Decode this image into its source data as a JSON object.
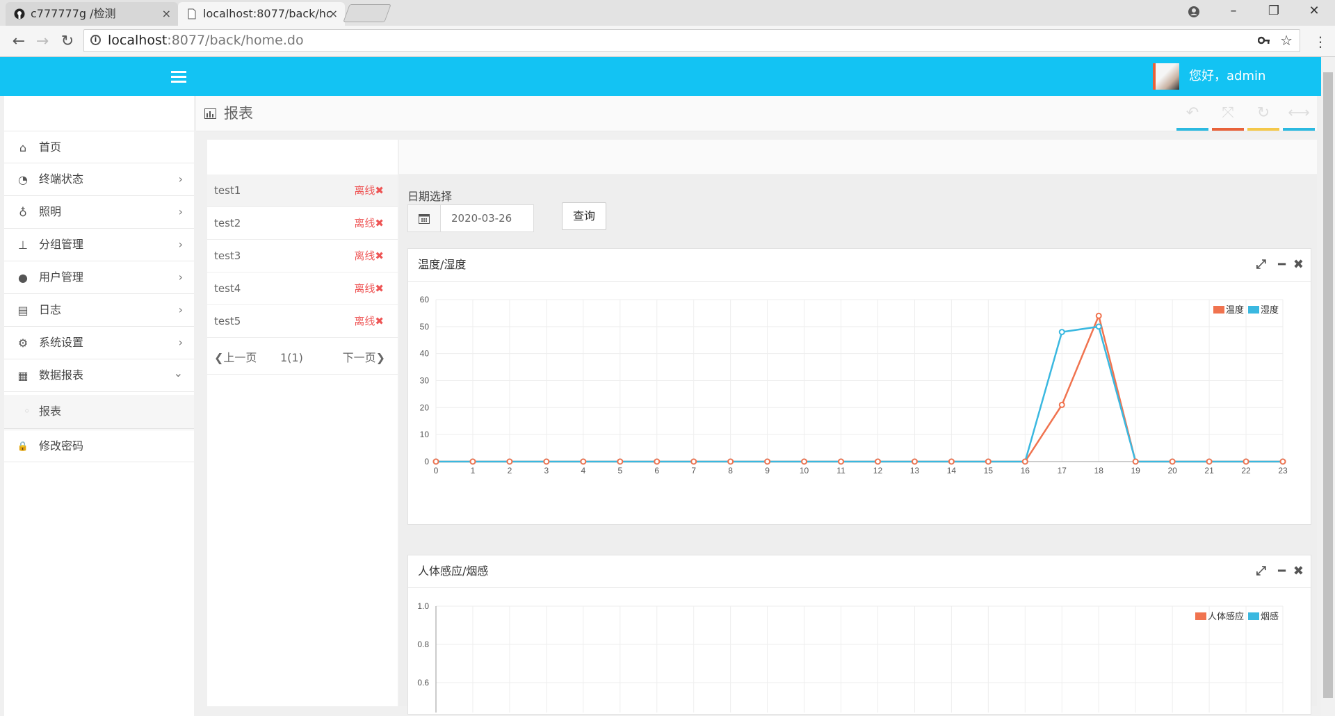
{
  "browser": {
    "tabs": [
      {
        "title": "c777777g /检测",
        "close": "×"
      },
      {
        "title": "localhost:8077/back/hc",
        "close": "×"
      }
    ],
    "url_host": "localhost",
    "url_rest": ":8077/back/home.do",
    "window_controls": {
      "minimize": "–",
      "maximize": "❐",
      "close": "✕"
    }
  },
  "header": {
    "greeting": "您好，admin"
  },
  "sidebar": {
    "items": [
      {
        "label": "首页",
        "icon": "home-icon",
        "glyph": "⌂"
      },
      {
        "label": "终端状态",
        "icon": "dashboard-icon",
        "glyph": "◔",
        "chevron": "›"
      },
      {
        "label": "照明",
        "icon": "lightbulb-icon",
        "glyph": "♁",
        "chevron": "›"
      },
      {
        "label": "分组管理",
        "icon": "sitemap-icon",
        "glyph": "⊥",
        "chevron": "›"
      },
      {
        "label": "用户管理",
        "icon": "user-icon",
        "glyph": "●",
        "chevron": "›"
      },
      {
        "label": "日志",
        "icon": "archive-icon",
        "glyph": "▤",
        "chevron": "›"
      },
      {
        "label": "系统设置",
        "icon": "gears-icon",
        "glyph": "⚙",
        "chevron": "›"
      },
      {
        "label": "数据报表",
        "icon": "bar-chart-icon",
        "glyph": "▦",
        "chevron": "⌄"
      }
    ],
    "sub_item": "报表",
    "bottom_item": {
      "label": "修改密码",
      "icon": "lock-icon",
      "glyph": "🔒"
    }
  },
  "page": {
    "title": "报表"
  },
  "devices": [
    {
      "name": "test1",
      "status": "离线✖"
    },
    {
      "name": "test2",
      "status": "离线✖"
    },
    {
      "name": "test3",
      "status": "离线✖"
    },
    {
      "name": "test4",
      "status": "离线✖"
    },
    {
      "name": "test5",
      "status": "离线✖"
    }
  ],
  "pager": {
    "prev": "❮上一页",
    "current": "1(1)",
    "next": "下一页❯"
  },
  "date_filter": {
    "label": "日期选择",
    "value": "2020-03-26",
    "query_button": "查询"
  },
  "toolbar_colors": [
    "#2bb9e0",
    "#e8623a",
    "#f4c84a",
    "#2bb9e0"
  ],
  "panels": [
    {
      "title": "温度/湿度"
    },
    {
      "title": "人体感应/烟感"
    }
  ],
  "chart_data": [
    {
      "type": "line",
      "title": "温度/湿度",
      "x": [
        0,
        1,
        2,
        3,
        4,
        5,
        6,
        7,
        8,
        9,
        10,
        11,
        12,
        13,
        14,
        15,
        16,
        17,
        18,
        19,
        20,
        21,
        22,
        23
      ],
      "ylim": [
        0,
        60
      ],
      "yticks": [
        0,
        10,
        20,
        30,
        40,
        50,
        60
      ],
      "grid": true,
      "legend": "top-right",
      "series": [
        {
          "name": "温度",
          "color": "#f0734f",
          "values": [
            0,
            0,
            0,
            0,
            0,
            0,
            0,
            0,
            0,
            0,
            0,
            0,
            0,
            0,
            0,
            0,
            0,
            21,
            54,
            0,
            0,
            0,
            0,
            0
          ]
        },
        {
          "name": "湿度",
          "color": "#3ab8e0",
          "values": [
            0,
            0,
            0,
            0,
            0,
            0,
            0,
            0,
            0,
            0,
            0,
            0,
            0,
            0,
            0,
            0,
            0,
            48,
            50,
            0,
            0,
            0,
            0,
            0
          ]
        }
      ]
    },
    {
      "type": "line",
      "title": "人体感应/烟感",
      "yticks_visible": [
        1.0,
        0.8,
        0.6
      ],
      "ytick_labels": [
        "1.0",
        "0.8",
        "0.6"
      ],
      "grid": true,
      "legend": "top-right",
      "series": [
        {
          "name": "人体感应",
          "color": "#f0734f"
        },
        {
          "name": "烟感",
          "color": "#3ab8e0"
        }
      ]
    }
  ]
}
